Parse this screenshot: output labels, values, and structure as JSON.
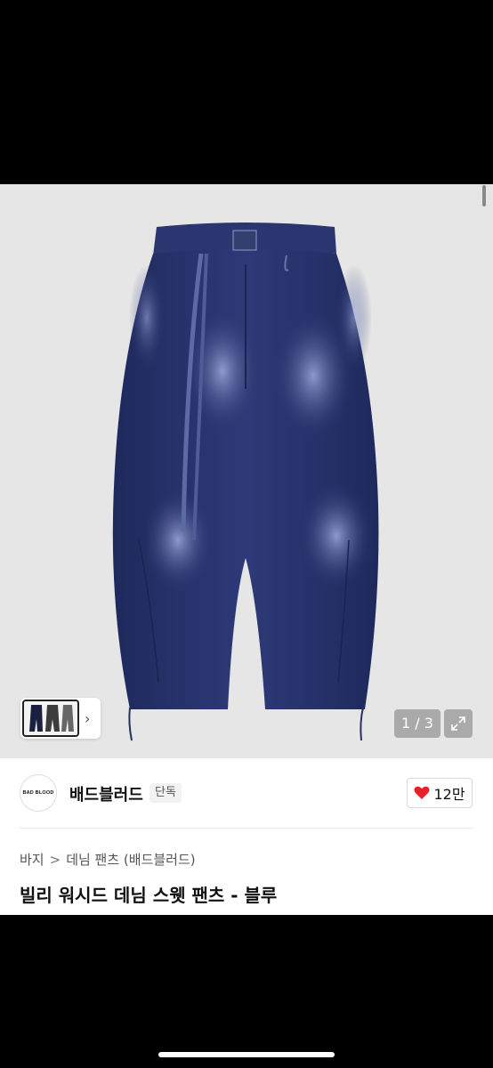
{
  "gallery": {
    "image_alt": "청바지 상품 이미지",
    "page_current": "1",
    "page_total": "3",
    "page_separator": "/",
    "thumbnail_chevron": "›"
  },
  "brand": {
    "logo_text": "BAD BLOOD",
    "name": "배드블러드",
    "badge": "단독"
  },
  "like": {
    "count": "12만",
    "icon": "heart-icon",
    "color": "#e8202a"
  },
  "breadcrumb": {
    "items": [
      "바지",
      "데님 팬츠 (배드블러드)"
    ],
    "separator": ">"
  },
  "product": {
    "title": "빌리 워시드 데님 스웻 팬츠 - 블루"
  },
  "colors": {
    "denim": "#2a3570",
    "background": "#e6e6e6"
  }
}
